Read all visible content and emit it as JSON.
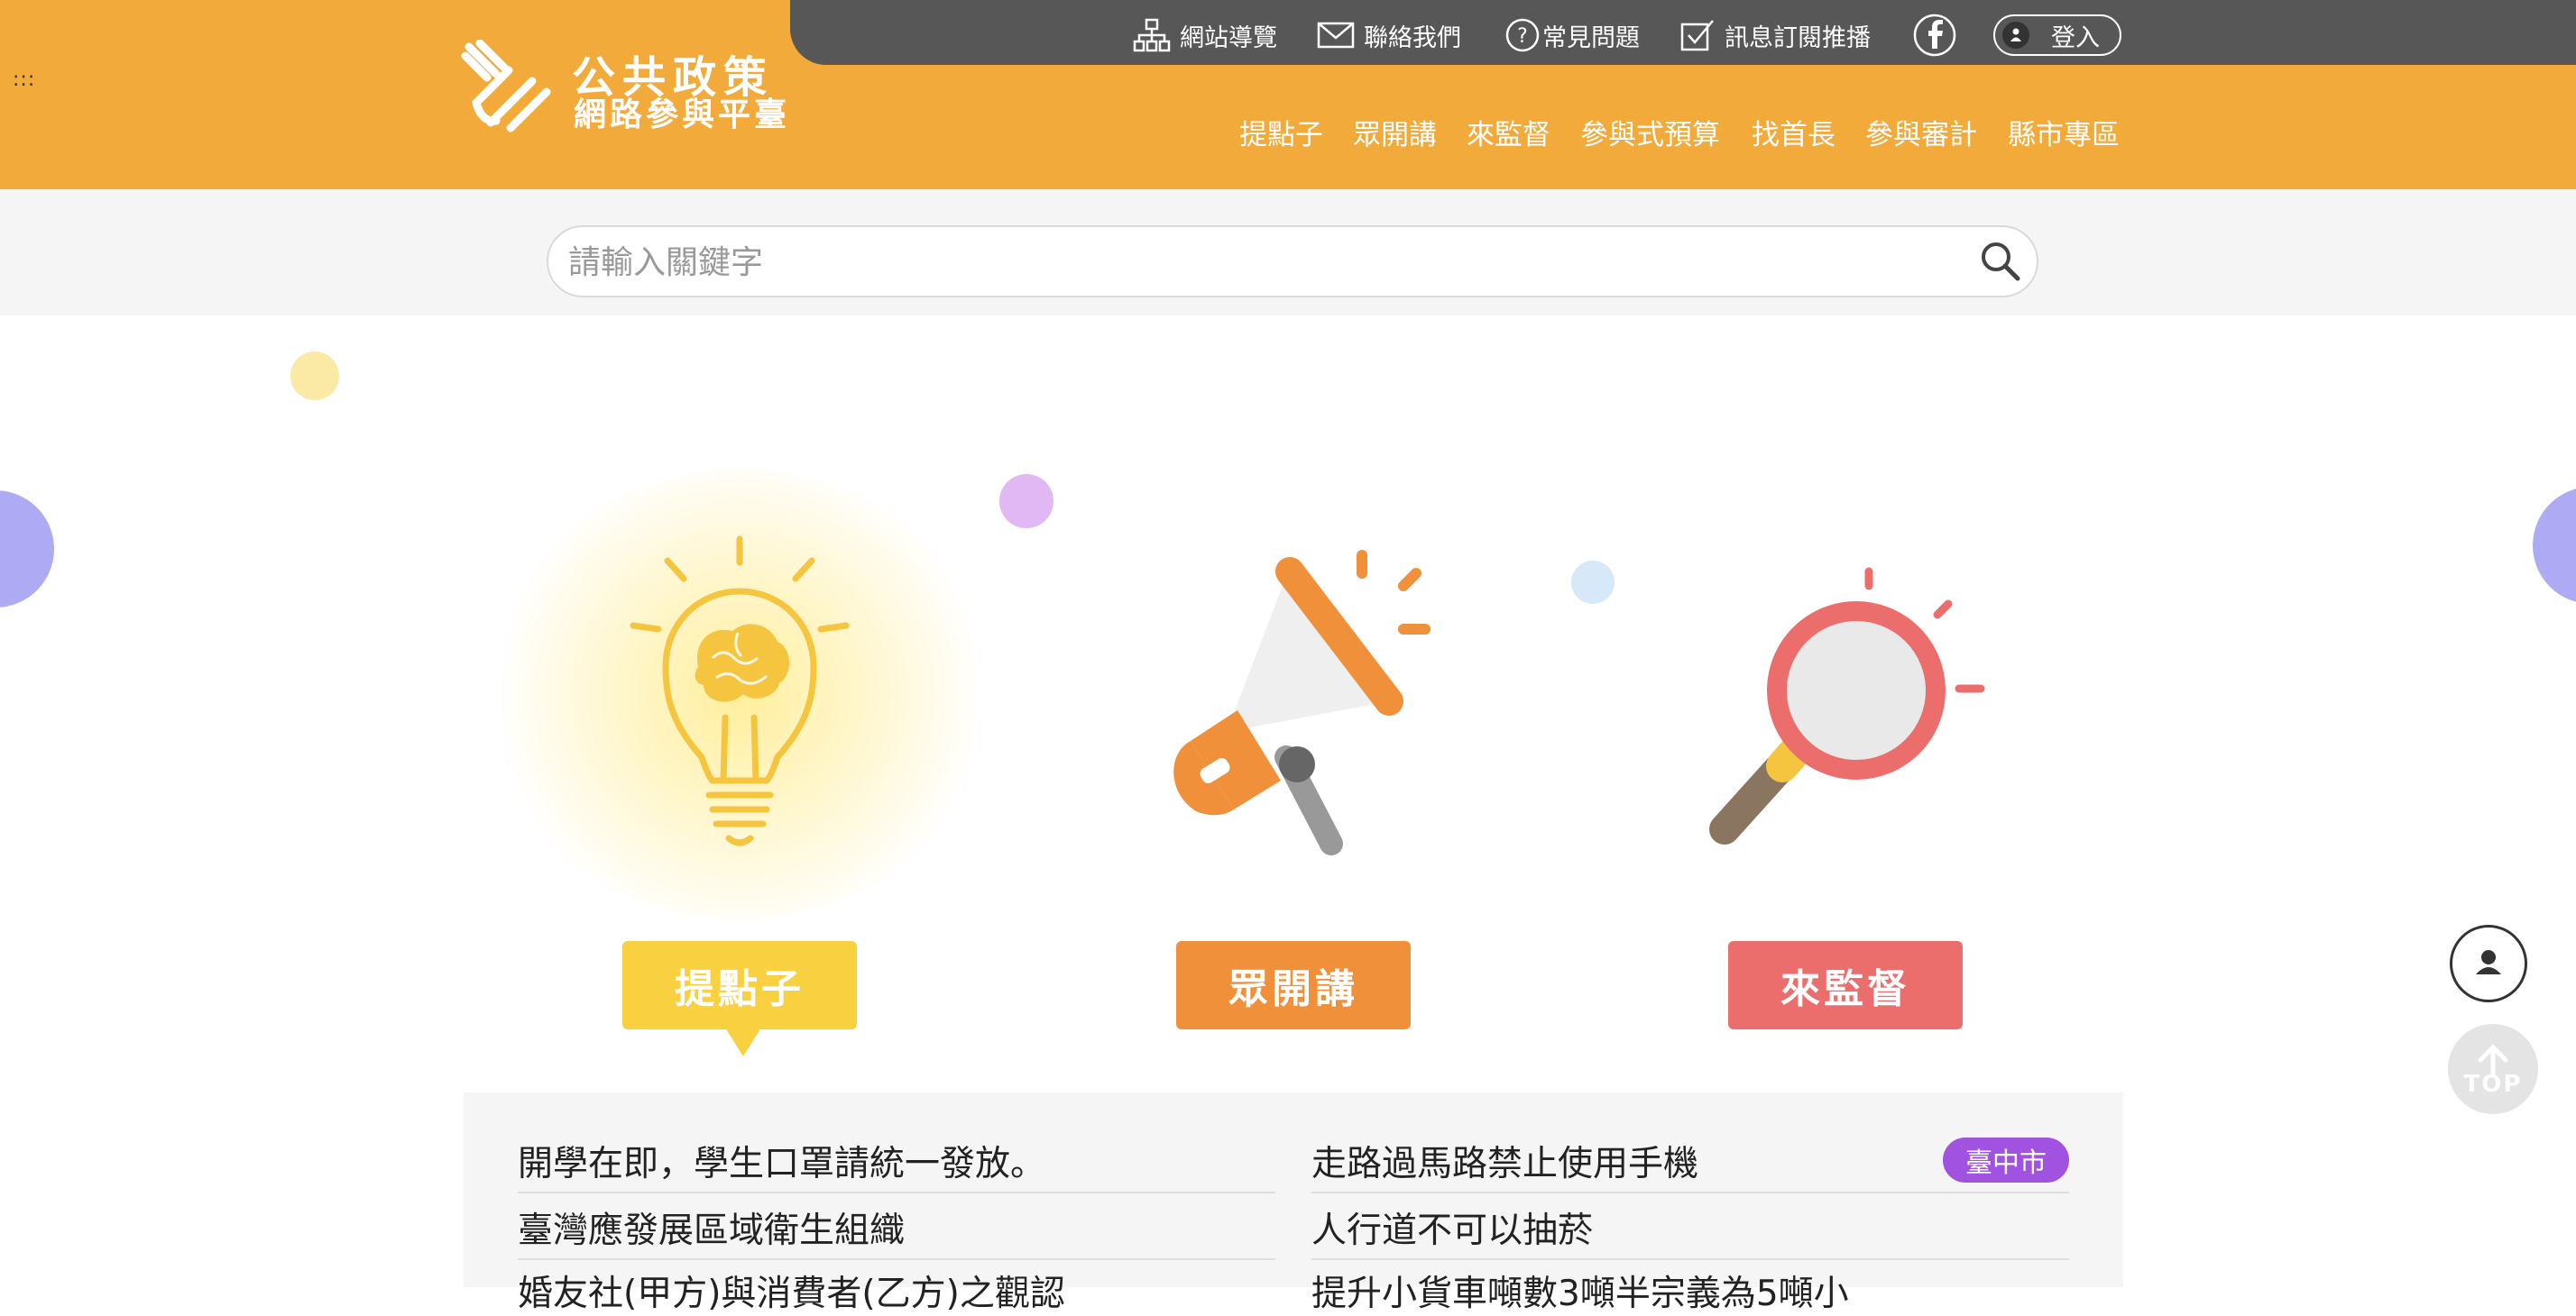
{
  "skip_link": ":::",
  "logo": {
    "title": "公共政策",
    "subtitle": "網路參與平臺"
  },
  "utility_nav": [
    {
      "label": "網站導覽",
      "icon": "sitemap-icon"
    },
    {
      "label": "聯絡我們",
      "icon": "mail-icon"
    },
    {
      "label": "常見問題",
      "icon": "question-icon"
    },
    {
      "label": "訊息訂閱推播",
      "icon": "checkbox-icon"
    },
    {
      "label": "",
      "icon": "facebook-icon"
    }
  ],
  "login_label": "登入",
  "main_nav": [
    "提點子",
    "眾開講",
    "來監督",
    "參與式預算",
    "找首長",
    "參與審計",
    "縣市專區"
  ],
  "search": {
    "placeholder": "請輸入關鍵字"
  },
  "features": [
    {
      "label": "提點子",
      "icon": "lightbulb-icon",
      "color": "#f8d040"
    },
    {
      "label": "眾開講",
      "icon": "megaphone-icon",
      "color": "#f0903a"
    },
    {
      "label": "來監督",
      "icon": "magnifier-icon",
      "color": "#ec6e6c"
    }
  ],
  "list_left": [
    "開學在即，學生口罩請統一發放。",
    "臺灣應發展區域衛生組織",
    "婚友社(甲方)與消費者(乙方)之觀認"
  ],
  "list_right": [
    {
      "text": "走路過馬路禁止使用手機",
      "badge": "臺中市"
    },
    {
      "text": "人行道不可以抽菸",
      "badge": ""
    },
    {
      "text": "提升小貨車噸數3噸半宗義為5噸小",
      "badge": ""
    }
  ],
  "top_label": "TOP",
  "colors": {
    "header": "#f2aa3b",
    "topbar": "#575757",
    "badge": "#a152e0"
  }
}
